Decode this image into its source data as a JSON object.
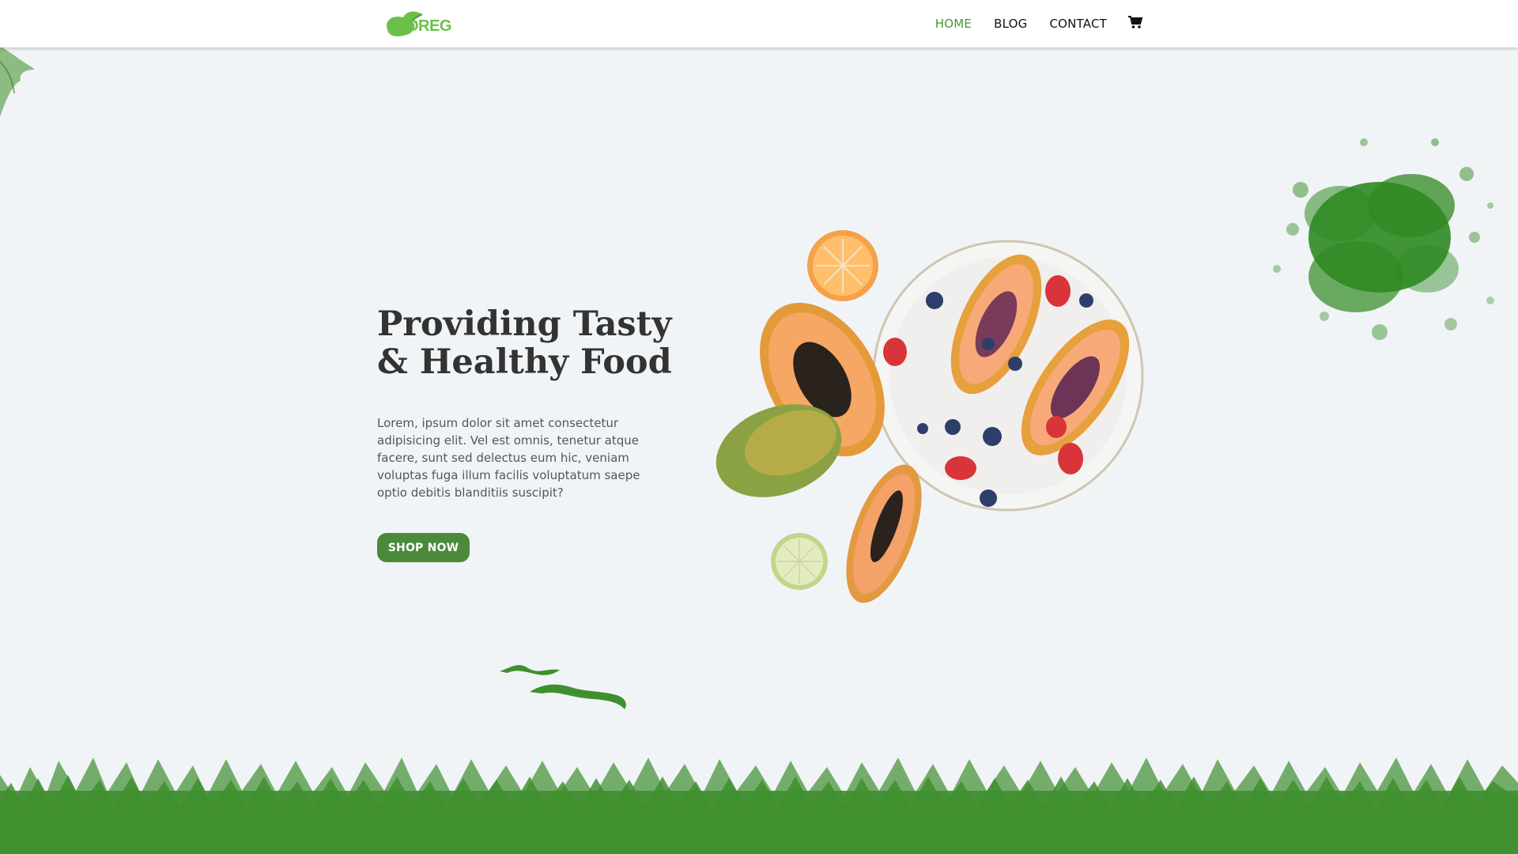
{
  "brand": {
    "logo_text": "OREG",
    "accent": "#6cc04a"
  },
  "nav": {
    "items": [
      {
        "label": "HOME",
        "active": true
      },
      {
        "label": "BLOG",
        "active": false
      },
      {
        "label": "CONTACT",
        "active": false
      }
    ],
    "cart_icon": "cart-icon",
    "active_color": "#3f9d2e"
  },
  "hero": {
    "title_line1": "Providing Tasty",
    "title_line2": "& Healthy Food",
    "description": "Lorem, ipsum dolor sit amet consectetur adipisicing elit. Vel est omnis, tenetur atque facere, sunt sed delectus eum hic, veniam voluptas fuga illum facilis voluptatum saepe optio debitis blanditiis suscipit?",
    "cta_label": "SHOP NOW",
    "cta_color": "#4b8a3a"
  },
  "colors": {
    "background": "#f1f4f7",
    "grass": "#3f8f2f",
    "splash": "#2f8a22"
  }
}
